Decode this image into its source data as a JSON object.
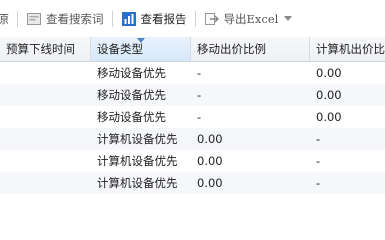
{
  "toolbar": {
    "restore_label": "还原",
    "view_search_terms_label": "查看搜索词",
    "view_report_label": "查看报告",
    "export_excel_label": "导出Excel"
  },
  "table": {
    "columns": [
      "预算下线时间",
      "设备类型",
      "移动出价比例",
      "计算机出价比"
    ],
    "rows": [
      [
        "",
        "移动设备优先",
        "-",
        "0.00"
      ],
      [
        "",
        "移动设备优先",
        "-",
        "0.00"
      ],
      [
        "",
        "移动设备优先",
        "-",
        "0.00"
      ],
      [
        "",
        "计算机设备优先",
        "0.00",
        "-"
      ],
      [
        "",
        "计算机设备优先",
        "0.00",
        "-"
      ],
      [
        "",
        "计算机设备优先",
        "0.00",
        "-"
      ]
    ]
  },
  "colors": {
    "accent": "#2a6fc9",
    "header_bg": "#eef0f3",
    "alt_row": "#f5f7fa"
  },
  "icons": {
    "view_search_terms": "search-terms-icon",
    "view_report": "bar-chart-icon",
    "export_excel": "export-icon",
    "dropdown": "caret-down-icon"
  }
}
